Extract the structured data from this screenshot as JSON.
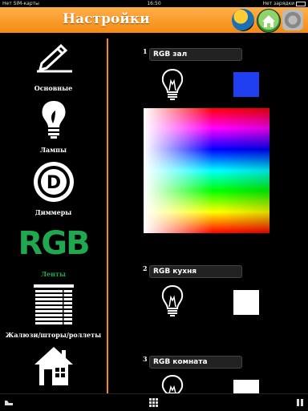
{
  "status_bar": {
    "carrier": "Нет SIM-карты",
    "time": "16:50",
    "battery": "Нет зарядки"
  },
  "header": {
    "title": "Настройки",
    "buttons": [
      "color-picker-icon",
      "home-icon",
      "gear-icon"
    ]
  },
  "sidebar": {
    "items": [
      {
        "label": "Основные",
        "icon": "pencil-icon",
        "active": false
      },
      {
        "label": "Лампы",
        "icon": "bulb-icon",
        "active": false
      },
      {
        "label": "Диммеры",
        "icon": "dimmer-icon",
        "active": false
      },
      {
        "label": "Ленты",
        "icon": "rgb-icon",
        "icon_text": "RGB",
        "active": true
      },
      {
        "label": "Жалюзи/шторы/роллеты",
        "icon": "blinds-icon",
        "active": false
      },
      {
        "label": "",
        "icon": "house-icon",
        "active": false
      }
    ]
  },
  "content": {
    "strips": [
      {
        "number": "1",
        "name": "RGB зал",
        "color": "#1f3ff0"
      },
      {
        "number": "2",
        "name": "RGB кухня",
        "color": "#ffffff"
      },
      {
        "number": "3",
        "name": "RGB комната",
        "color": "#ffffff"
      }
    ]
  },
  "bottom_bar": {
    "icons": [
      "tray-icon",
      "grid-icon",
      "pause-icon"
    ]
  }
}
